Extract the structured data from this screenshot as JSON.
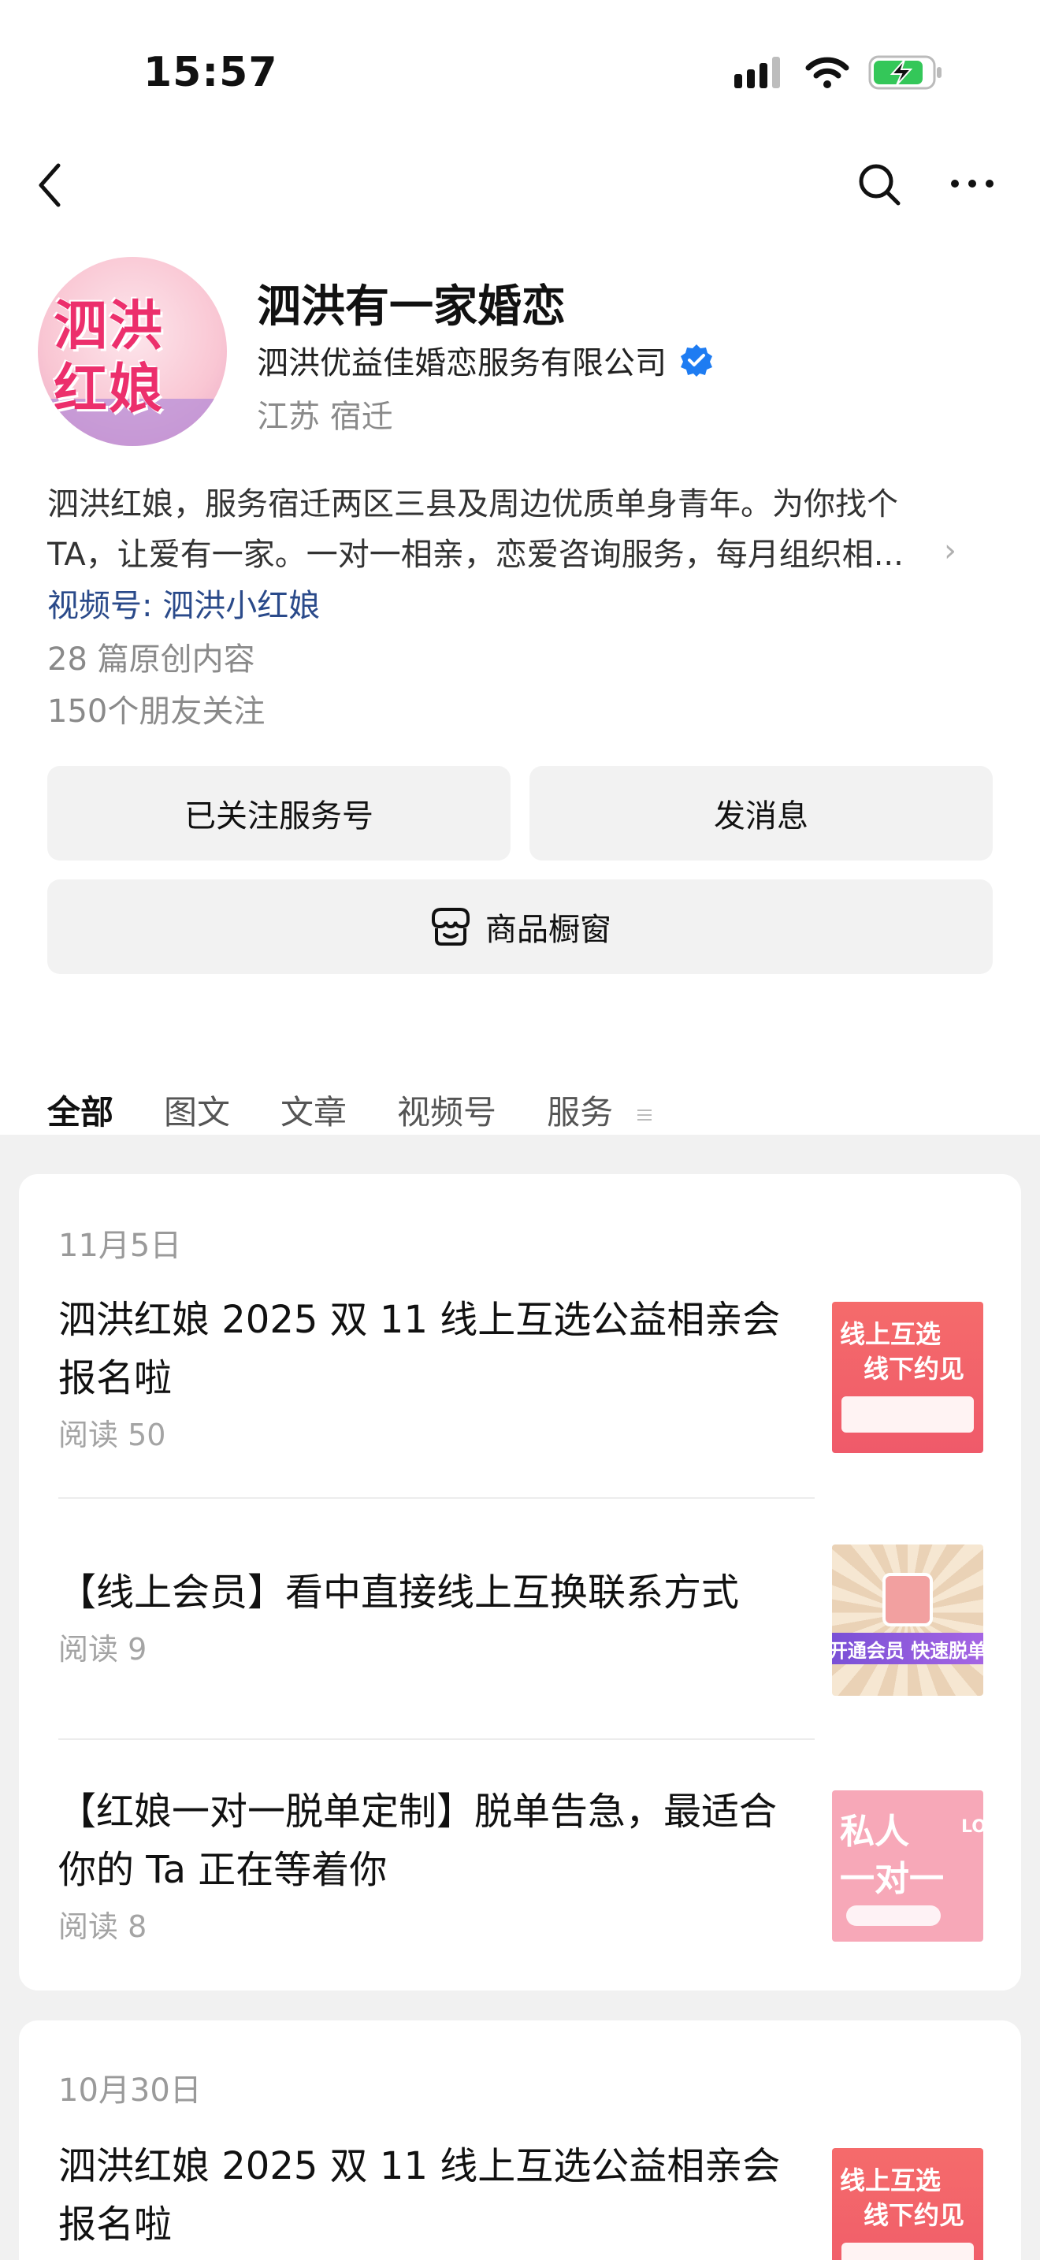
{
  "status_bar": {
    "time": "15:57"
  },
  "profile": {
    "avatar_text": "泗洪红娘",
    "name": "泗洪有一家婚恋",
    "company": "泗洪优益佳婚恋服务有限公司",
    "location": "江苏 宿迁",
    "description_lines": [
      "泗洪红娘，服务宿迁两区三县及周边优质单身青年。为你找个",
      "TA，让爱有一家。一对一相亲，恋爱咨询服务，每月组织相..."
    ],
    "channel": "视频号: 泗洪小红娘",
    "original_count": "28 篇原创内容",
    "friends_following": "150个朋友关注"
  },
  "actions": {
    "follow_label": "已关注服务号",
    "message_label": "发消息",
    "shop_label": "商品橱窗"
  },
  "tabs": [
    "全部",
    "图文",
    "文章",
    "视频号",
    "服务"
  ],
  "feed": [
    {
      "date": "11月5日",
      "articles": [
        {
          "title_lines": [
            "泗洪红娘 2025 双 11 线上互选公益相亲会",
            "报名啦"
          ],
          "reads": "阅读 50",
          "thumb": {
            "line1": "线上互选",
            "line2": "线下约见"
          }
        },
        {
          "title_lines": [
            "【线上会员】看中直接线上互换联系方式"
          ],
          "reads": "阅读 9",
          "thumb": {
            "band": "开通会员 快速脱单"
          }
        },
        {
          "title_lines": [
            "【红娘一对一脱单定制】脱单告急，最适合",
            "你的 Ta 正在等着你"
          ],
          "reads": "阅读 8",
          "thumb": {
            "line1": "私人",
            "line2": "一对一",
            "corner": "LO"
          }
        }
      ]
    },
    {
      "date": "10月30日",
      "articles": [
        {
          "title_lines": [
            "泗洪红娘 2025 双 11 线上互选公益相亲会",
            "报名啦"
          ],
          "thumb": {
            "line1": "线上互选",
            "line2": "线下约见"
          }
        }
      ]
    }
  ],
  "colors": {
    "accent_link": "#2a4a8a",
    "verified_blue": "#1e7cf2",
    "battery_green": "#34c759"
  }
}
